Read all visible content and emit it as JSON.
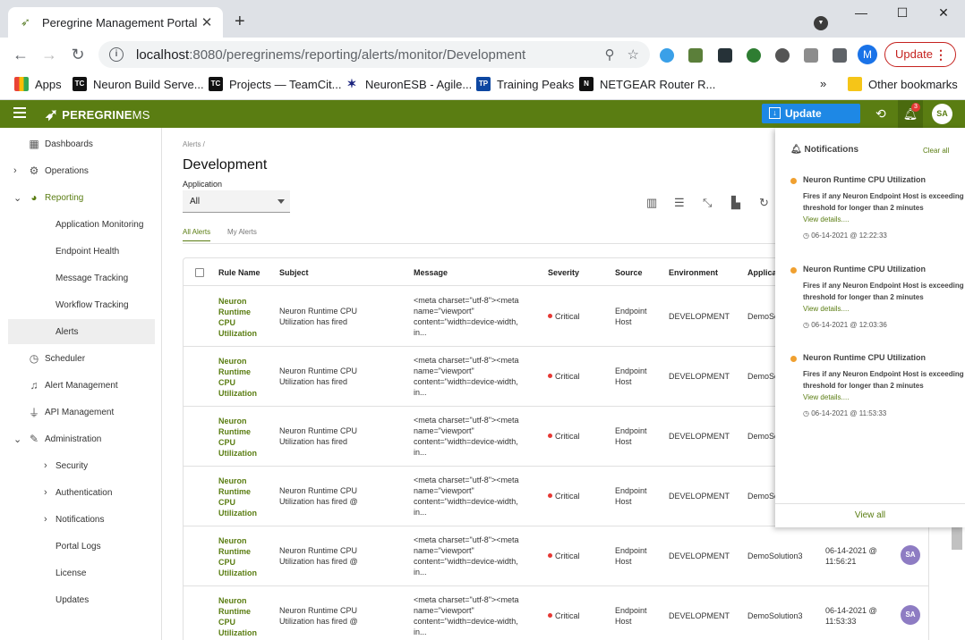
{
  "browser": {
    "tab_title": "Peregrine Management Portal",
    "tab_close": "✕",
    "new_tab": "+",
    "url_host": "localhost",
    "url_path": ":8080/peregrinems/reporting/alerts/monitor/Development",
    "profile_initial": "M",
    "update_label": "Update",
    "update_menu": "⋮",
    "bookmarks": [
      {
        "label": "Apps",
        "icon": "apps-icon"
      },
      {
        "label": "Neuron Build Serve...",
        "icon": "teamcity-icon"
      },
      {
        "label": "Projects — TeamCit...",
        "icon": "teamcity-icon"
      },
      {
        "label": "NeuronESB - Agile...",
        "icon": "neuron-icon"
      },
      {
        "label": "Training Peaks",
        "icon": "trainingpeaks-icon"
      },
      {
        "label": "NETGEAR Router R...",
        "icon": "netgear-icon"
      }
    ],
    "bookmarks_more": "»",
    "other_bookmarks": "Other bookmarks"
  },
  "header": {
    "brand": "PEREGRINE",
    "brand_suffix": "MS",
    "update_available": "Update Available",
    "notification_count": "3",
    "user_initials": "SA",
    "accent": "#5a7d12"
  },
  "sidebar": {
    "items": [
      {
        "label": "Dashboards"
      },
      {
        "label": "Operations"
      },
      {
        "label": "Reporting"
      },
      {
        "label": "Application Monitoring"
      },
      {
        "label": "Endpoint Health"
      },
      {
        "label": "Message Tracking"
      },
      {
        "label": "Workflow Tracking"
      },
      {
        "label": "Alerts"
      },
      {
        "label": "Scheduler"
      },
      {
        "label": "Alert Management"
      },
      {
        "label": "API Management"
      },
      {
        "label": "Administration"
      },
      {
        "label": "Security"
      },
      {
        "label": "Authentication"
      },
      {
        "label": "Notifications"
      },
      {
        "label": "Portal Logs"
      },
      {
        "label": "License"
      },
      {
        "label": "Updates"
      }
    ]
  },
  "main": {
    "breadcrumb": "Alerts /",
    "title": "Development",
    "application_label": "Application",
    "application_value": "All",
    "tabs": [
      "All Alerts",
      "My Alerts"
    ]
  },
  "table": {
    "columns": [
      "Rule Name",
      "Subject",
      "Message",
      "Severity",
      "Source",
      "Environment",
      "Applicat"
    ],
    "rows": [
      {
        "rule": "Neuron Runtime CPU Utilization",
        "subject": "Neuron Runtime CPU Utilization has fired",
        "message": "<meta charset=\"utf-8\"><meta name=\"viewport\" content=\"width=device-width, in...",
        "severity": "Critical",
        "source": "Endpoint Host",
        "environment": "DEVELOPMENT",
        "application": "DemoSo",
        "date": "",
        "user": ""
      },
      {
        "rule": "Neuron Runtime CPU Utilization",
        "subject": "Neuron Runtime CPU Utilization has fired",
        "message": "<meta charset=\"utf-8\"><meta name=\"viewport\" content=\"width=device-width, in...",
        "severity": "Critical",
        "source": "Endpoint Host",
        "environment": "DEVELOPMENT",
        "application": "DemoSo",
        "date": "",
        "user": ""
      },
      {
        "rule": "Neuron Runtime CPU Utilization",
        "subject": "Neuron Runtime CPU Utilization has fired",
        "message": "<meta charset=\"utf-8\"><meta name=\"viewport\" content=\"width=device-width, in...",
        "severity": "Critical",
        "source": "Endpoint Host",
        "environment": "DEVELOPMENT",
        "application": "DemoSo",
        "date": "",
        "user": ""
      },
      {
        "rule": "Neuron Runtime CPU Utilization",
        "subject": "Neuron Runtime CPU Utilization has fired @",
        "message": "<meta charset=\"utf-8\"><meta name=\"viewport\" content=\"width=device-width, in...",
        "severity": "Critical",
        "source": "Endpoint Host",
        "environment": "DEVELOPMENT",
        "application": "DemoSo",
        "date": "",
        "user": ""
      },
      {
        "rule": "Neuron Runtime CPU Utilization",
        "subject": "Neuron Runtime CPU Utilization has fired @",
        "message": "<meta charset=\"utf-8\"><meta name=\"viewport\" content=\"width=device-width, in...",
        "severity": "Critical",
        "source": "Endpoint Host",
        "environment": "DEVELOPMENT",
        "application": "DemoSolution3",
        "date": "06-14-2021 @ 11:56:21",
        "user": "SA"
      },
      {
        "rule": "Neuron Runtime CPU Utilization",
        "subject": "Neuron Runtime CPU Utilization has fired @",
        "message": "<meta charset=\"utf-8\"><meta name=\"viewport\" content=\"width=device-width, in...",
        "severity": "Critical",
        "source": "Endpoint Host",
        "environment": "DEVELOPMENT",
        "application": "DemoSolution3",
        "date": "06-14-2021 @ 11:53:33",
        "user": "SA"
      }
    ]
  },
  "notifications": {
    "title": "Notifications",
    "clear_all": "Clear all",
    "view_all": "View all",
    "items": [
      {
        "title": "Neuron Runtime CPU Utilization",
        "desc": "Fires if any Neuron Endpoint Host is exceeding a threshold for longer than 2 minutes",
        "link": "View details....",
        "time": "06-14-2021 @ 12:22:33"
      },
      {
        "title": "Neuron Runtime CPU Utilization",
        "desc": "Fires if any Neuron Endpoint Host is exceeding a threshold for longer than 2 minutes",
        "link": "View details....",
        "time": "06-14-2021 @ 12:03:36"
      },
      {
        "title": "Neuron Runtime CPU Utilization",
        "desc": "Fires if any Neuron Endpoint Host is exceeding a threshold for longer than 2 minutes",
        "link": "View details....",
        "time": "06-14-2021 @ 11:53:33"
      }
    ]
  }
}
